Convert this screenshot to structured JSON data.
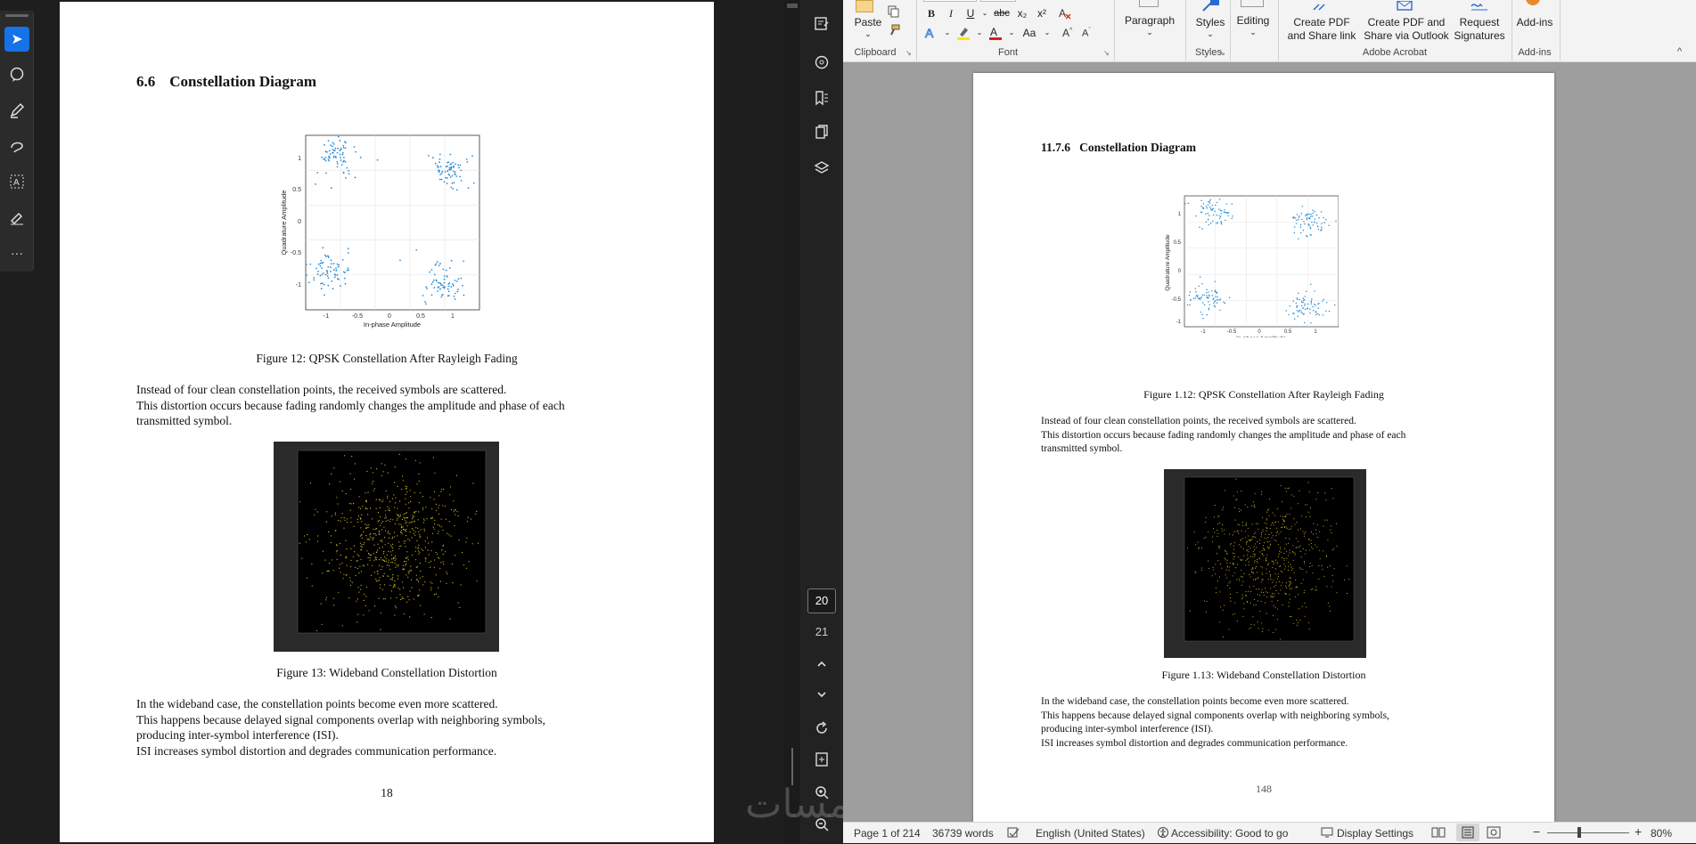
{
  "pdf": {
    "section_number": "6.6",
    "section_title": "Constellation Diagram",
    "fig1_caption": "Figure 12: QPSK Constellation After Rayleigh Fading",
    "para1_line1": "Instead of four clean constellation points, the received symbols are scattered.",
    "para1_line2": "This distortion occurs because fading randomly changes the amplitude and phase of each",
    "para1_line3": "transmitted symbol.",
    "fig2_caption": "Figure 13: Wideband Constellation Distortion",
    "para2_line1": "In the wideband case, the constellation points become even more scattered.",
    "para2_line2": "This happens because delayed signal components overlap with neighboring symbols,",
    "para2_line3": "producing inter-symbol interference (ISI).",
    "para2_line4": "ISI increases symbol distortion and degrades communication performance.",
    "page_number": "18"
  },
  "plot": {
    "xlabel": "In-phase Amplitude",
    "ylabel": "Quadrature Amplitude",
    "xticks": [
      "-1",
      "-0.5",
      "0",
      "0.5",
      "1"
    ],
    "yticks": [
      "1",
      "0.5",
      "0",
      "-0.5",
      "-1"
    ]
  },
  "acrobat": {
    "page_current": "20",
    "page_next": "21"
  },
  "word_doc": {
    "section_heading": "11.7.6   Constellation Diagram",
    "fig1_caption": "Figure 1.12: QPSK Constellation After Rayleigh Fading",
    "para1_line1": "Instead of four clean constellation points, the received symbols are scattered.",
    "para1_line2": "This distortion occurs because fading randomly changes the amplitude and phase of each",
    "para1_line3": "transmitted symbol.",
    "fig2_caption": "Figure 1.13: Wideband Constellation Distortion",
    "para2_line1": "In the wideband case, the constellation points become even more scattered.",
    "para2_line2": "This happens because delayed signal components overlap with neighboring symbols,",
    "para2_line3": "producing inter-symbol interference (ISI).",
    "para2_line4": "ISI increases symbol distortion and degrades communication performance.",
    "page_number": "148"
  },
  "ribbon": {
    "paste": "Paste",
    "clipboard": "Clipboard",
    "font": "Font",
    "paragraph": "Paragraph",
    "styles_btn": "Styles",
    "styles_group": "Styles",
    "editing": "Editing",
    "create_pdf_link_1": "Create PDF",
    "create_pdf_link_2": "and Share link",
    "create_pdf_outlook_1": "Create PDF and",
    "create_pdf_outlook_2": "Share via Outlook",
    "request_sig_1": "Request",
    "request_sig_2": "Signatures",
    "adobe_acrobat": "Adobe Acrobat",
    "addins_btn": "Add-ins",
    "addins_group": "Add-ins",
    "bold": "B",
    "italic": "I",
    "underline": "U",
    "strike": "abc",
    "subscript": "x₂",
    "superscript": "x²",
    "case_btn": "Aa"
  },
  "status": {
    "page": "Page 1 of 214",
    "words": "36739 words",
    "language": "English (United States)",
    "accessibility": "Accessibility: Good to go",
    "display_settings": "Display Settings",
    "zoom": "80%"
  },
  "watermark": "خمسات"
}
